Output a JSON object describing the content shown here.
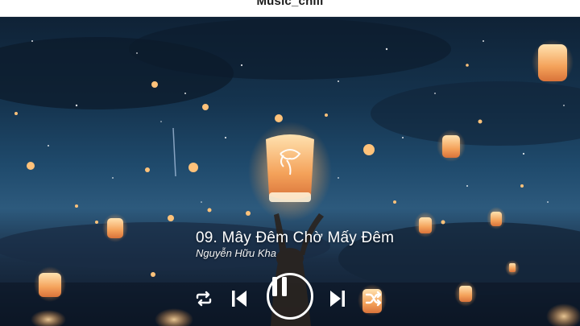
{
  "app": {
    "title": "Music_chill"
  },
  "now_playing": {
    "title": "09. Mây Đêm Chờ Mấy Đêm",
    "artist": "Nguyễn Hữu Kha"
  },
  "controls": {
    "repeat": {
      "icon": "repeat-icon"
    },
    "previous": {
      "icon": "skip-previous-icon"
    },
    "play_pause": {
      "icon": "pause-icon",
      "state": "playing"
    },
    "next": {
      "icon": "skip-next-icon"
    },
    "shuffle": {
      "icon": "shuffle-icon"
    }
  },
  "colors": {
    "sky_top": "#0f2236",
    "sky_mid": "#1f4a6c",
    "lantern": "#f4a25a",
    "control": "#ffffff"
  }
}
